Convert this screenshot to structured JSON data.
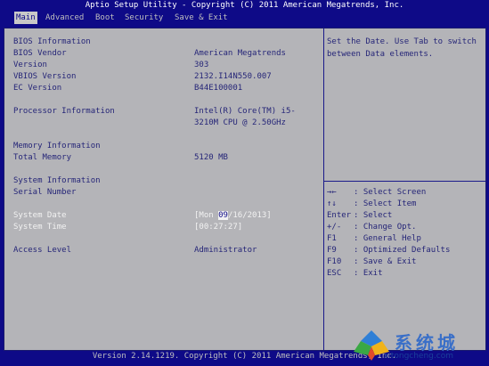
{
  "title": "Aptio Setup Utility - Copyright (C) 2011 American Megatrends, Inc.",
  "menu": [
    {
      "label": "Main",
      "active": true
    },
    {
      "label": "Advanced",
      "active": false
    },
    {
      "label": "Boot",
      "active": false
    },
    {
      "label": "Security",
      "active": false
    },
    {
      "label": "Save & Exit",
      "active": false
    }
  ],
  "info": {
    "bios_info_label": "BIOS Information",
    "bios_vendor_label": "BIOS Vendor",
    "bios_vendor_value": "American Megatrends",
    "version_label": "Version",
    "version_value": "303",
    "vbios_label": "VBIOS Version",
    "vbios_value": "2132.I14N550.007",
    "ec_label": "EC Version",
    "ec_value": "B44E100001",
    "processor_label": "Processor Information",
    "processor_value_1": "Intel(R) Core(TM) i5-",
    "processor_value_2": "3210M CPU @ 2.50GHz",
    "memory_label": "Memory Information",
    "total_memory_label": "Total Memory",
    "total_memory_value": "5120 MB",
    "system_info_label": "System Information",
    "serial_label": "Serial Number",
    "system_date_label": "System Date",
    "system_date_prefix": "[Mon ",
    "system_date_cursor": "09",
    "system_date_suffix": "/16/2013]",
    "system_time_label": "System Time",
    "system_time_value": "[00:27:27]",
    "access_label": "Access Level",
    "access_value": "Administrator"
  },
  "help": {
    "text": "Set the Date. Use Tab to switch between Data elements."
  },
  "keys": [
    {
      "key": "→←",
      "desc": ": Select Screen"
    },
    {
      "key": "↑↓",
      "desc": ": Select Item"
    },
    {
      "key": "Enter",
      "desc": ": Select"
    },
    {
      "key": "+/-",
      "desc": ": Change Opt."
    },
    {
      "key": "F1",
      "desc": ": General Help"
    },
    {
      "key": "F9",
      "desc": ": Optimized Defaults"
    },
    {
      "key": "F10",
      "desc": ": Save & Exit"
    },
    {
      "key": "ESC",
      "desc": ": Exit"
    }
  ],
  "footer": "Version 2.14.1219. Copyright (C) 2011 American Megatrends, Inc.",
  "watermark": {
    "text": "系统城",
    "url": "xitongcheng.com",
    "logo_colors": [
      "#2f7fd6",
      "#f0b31a",
      "#3aa844",
      "#e04a2a"
    ]
  }
}
